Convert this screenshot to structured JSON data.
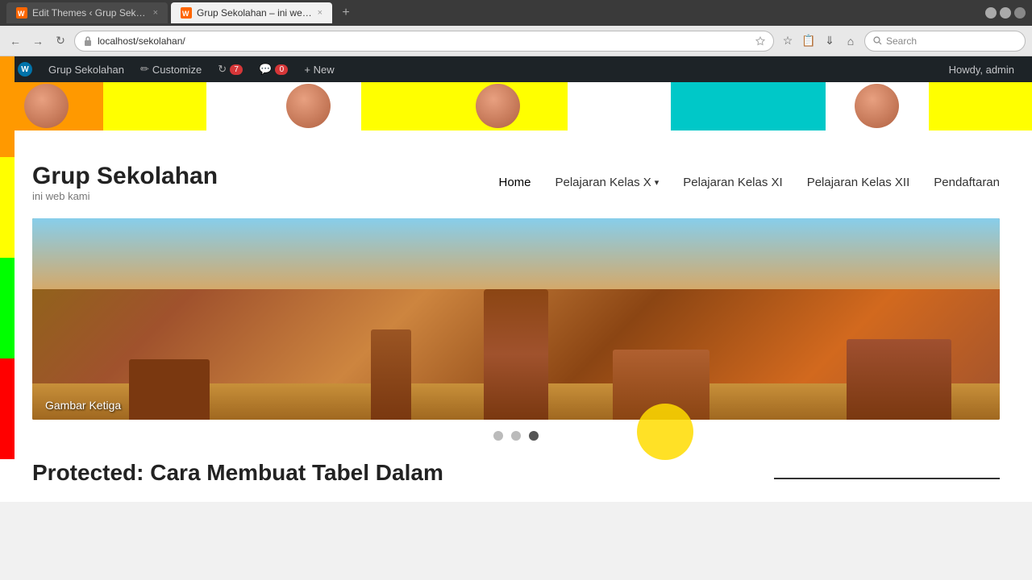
{
  "browser": {
    "tabs": [
      {
        "id": "tab1",
        "label": "Edit Themes ‹ Grup Sekola...",
        "url": "",
        "active": false
      },
      {
        "id": "tab2",
        "label": "Grup Sekolahan – ini web k...",
        "url": "localhost/sekolahan/",
        "active": true
      }
    ],
    "address": "localhost/sekolahan/",
    "search_placeholder": "Search"
  },
  "wp_admin_bar": {
    "items": [
      {
        "id": "wp-logo",
        "label": "W"
      },
      {
        "id": "site-name",
        "label": "Grup Sekolahan"
      },
      {
        "id": "customize",
        "label": "Customize"
      },
      {
        "id": "updates",
        "label": "7"
      },
      {
        "id": "comments",
        "label": "0"
      },
      {
        "id": "new",
        "label": "+ New"
      }
    ],
    "greeting": "Howdy, admin"
  },
  "site": {
    "title": "Grup Sekolahan",
    "tagline": "ini web kami",
    "nav": [
      {
        "id": "home",
        "label": "Home",
        "active": true
      },
      {
        "id": "kelas-x",
        "label": "Pelajaran Kelas X",
        "has_dropdown": true
      },
      {
        "id": "kelas-xi",
        "label": "Pelajaran Kelas XI",
        "has_dropdown": false
      },
      {
        "id": "kelas-xii",
        "label": "Pelajaran Kelas XII",
        "has_dropdown": false
      },
      {
        "id": "pendaftaran",
        "label": "Pendaftaran",
        "has_dropdown": false
      }
    ]
  },
  "slider": {
    "caption": "Gambar Ketiga",
    "dots": [
      {
        "id": 1,
        "active": false
      },
      {
        "id": 2,
        "active": false
      },
      {
        "id": 3,
        "active": true
      }
    ]
  },
  "article": {
    "title": "Protected: Cara Membuat Tabel Dalam"
  }
}
